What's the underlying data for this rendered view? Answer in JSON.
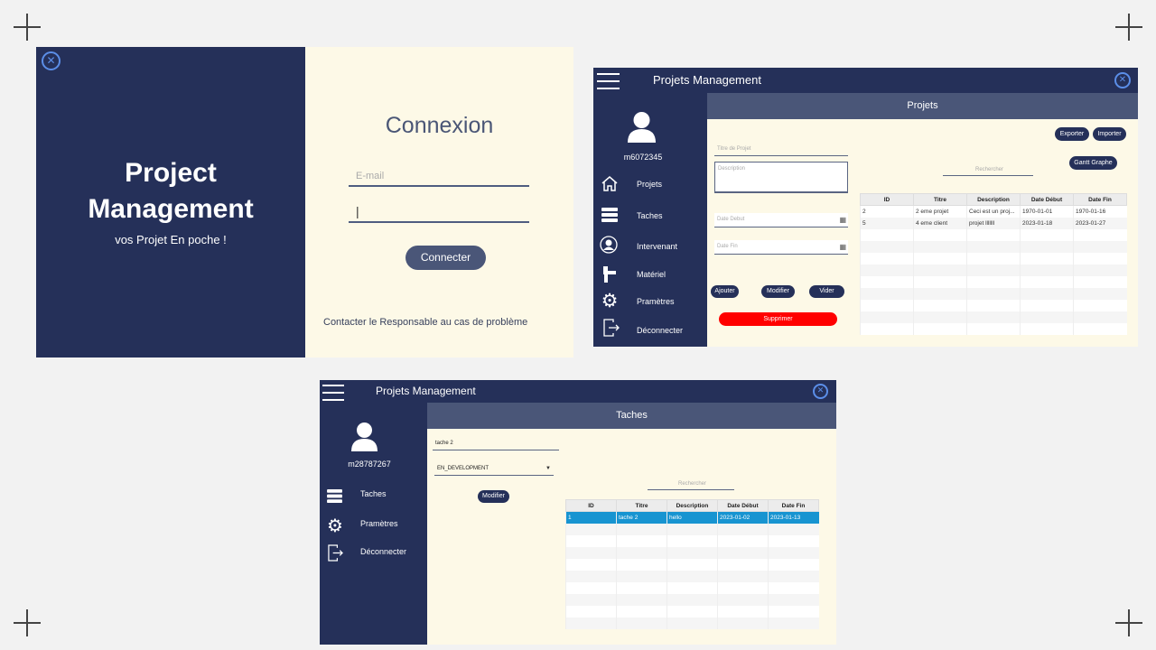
{
  "login": {
    "title_line1": "Project",
    "title_line2": "Management",
    "tagline": "vos Projet En poche !",
    "heading": "Connexion",
    "email_placeholder": "E-mail",
    "password_value": "|",
    "connect_button": "Connecter",
    "contact_text": "Contacter le Responsable au cas de problème"
  },
  "projects_window": {
    "title": "Projets Management",
    "user_id": "m6072345",
    "section_title": "Projets",
    "menu": [
      {
        "label": "Projets",
        "icon": "home-icon"
      },
      {
        "label": "Taches",
        "icon": "list-icon"
      },
      {
        "label": "Intervenant",
        "icon": "person-icon"
      },
      {
        "label": "Matériel",
        "icon": "tool-icon"
      },
      {
        "label": "Pramètres",
        "icon": "gear-icon"
      },
      {
        "label": "Déconnecter",
        "icon": "logout-icon"
      }
    ],
    "form": {
      "title_placeholder": "Titre de Projet",
      "description_placeholder": "Description",
      "start_placeholder": "Date Debut",
      "end_placeholder": "Date Fin"
    },
    "buttons": {
      "add": "Ajouter",
      "modify": "Modifier",
      "clear": "Vider",
      "delete": "Supprimer",
      "export": "Exporter",
      "import": "Importer",
      "gantt": "Gantt Graphe"
    },
    "search_placeholder": "Rechercher",
    "table": {
      "columns": [
        "ID",
        "Titre",
        "Description",
        "Date Début",
        "Date Fin"
      ],
      "rows": [
        [
          "2",
          "2 eme projet",
          "Ceci est un proj...",
          "1970-01-01",
          "1970-01-16"
        ],
        [
          "5",
          "4 eme client",
          "projet lllllll",
          "2023-01-18",
          "2023-01-27"
        ]
      ]
    }
  },
  "tasks_window": {
    "title": "Projets Management",
    "user_id": "m28787267",
    "section_title": "Taches",
    "menu": [
      {
        "label": "Taches",
        "icon": "list-icon"
      },
      {
        "label": "Pramètres",
        "icon": "gear-icon"
      },
      {
        "label": "Déconnecter",
        "icon": "logout-icon"
      }
    ],
    "task_name_value": "tache 2",
    "status_value": "EN_DEVELOPMENT",
    "modify_button": "Modifier",
    "search_placeholder": "Rechercher",
    "table": {
      "columns": [
        "ID",
        "Titre",
        "Description",
        "Date Début",
        "Date Fin"
      ],
      "rows": [
        [
          "1",
          "tache 2",
          "hello",
          "2023-01-02",
          "2023-01-13"
        ]
      ]
    }
  },
  "colors": {
    "navy": "#253059",
    "slate": "#4a5678",
    "cream": "#fdf9e7",
    "danger": "#ff0000",
    "selection": "#1794d1",
    "close_icon": "#5b8ee8"
  }
}
